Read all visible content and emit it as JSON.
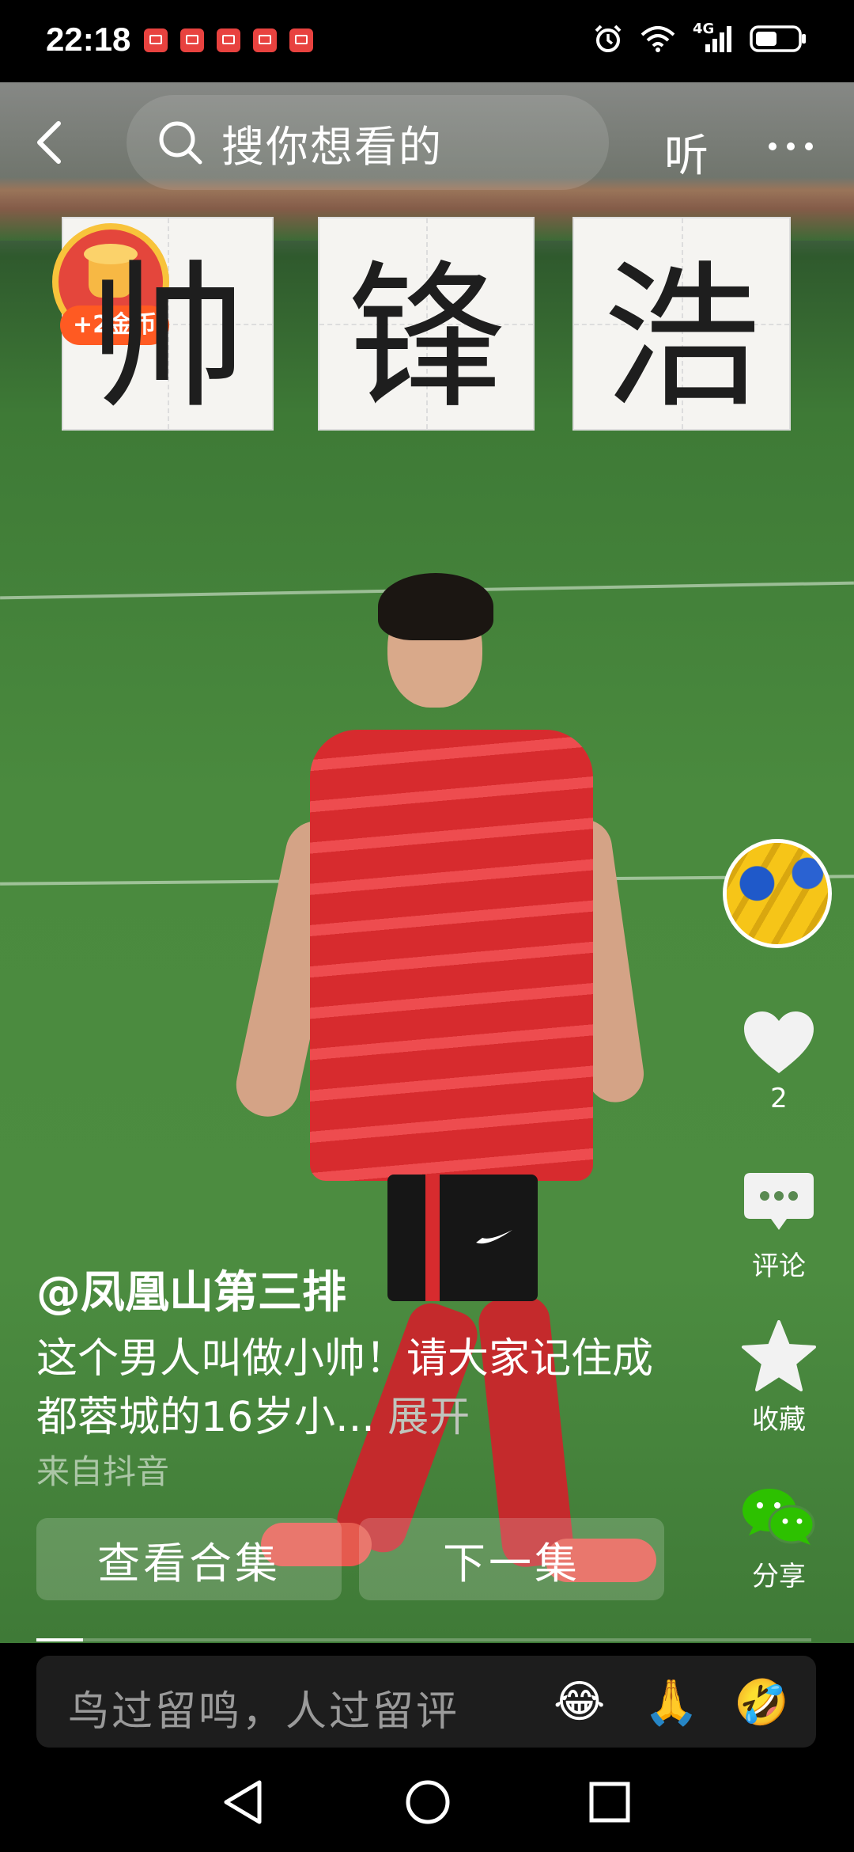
{
  "status_bar": {
    "time": "22:18",
    "network": "4G"
  },
  "top_bar": {
    "search_placeholder": "搜你想看的",
    "listen_label": "听"
  },
  "calligraphy_cards": [
    "帅",
    "锋",
    "浩"
  ],
  "coin_reward": {
    "label": "+2金币"
  },
  "right_rail": {
    "like_count": "2",
    "comment_label": "评论",
    "favorite_label": "收藏",
    "share_label": "分享"
  },
  "caption": {
    "author": "@凤凰山第三排",
    "description": "这个男人叫做小帅！请大家记住成都蓉城的16岁小...",
    "expand_label": "展开",
    "source": "来自抖音"
  },
  "actions": {
    "collection_button": "查看合集",
    "next_button": "下一集"
  },
  "comment_bar": {
    "placeholder": "鸟过留鸣，人过留评",
    "emojis": [
      "😂",
      "🙏",
      "🤣"
    ]
  },
  "colors": {
    "coin_badge": "#e4463c",
    "coin_label": "#ff5a22",
    "wechat_green": "#2dc100"
  }
}
